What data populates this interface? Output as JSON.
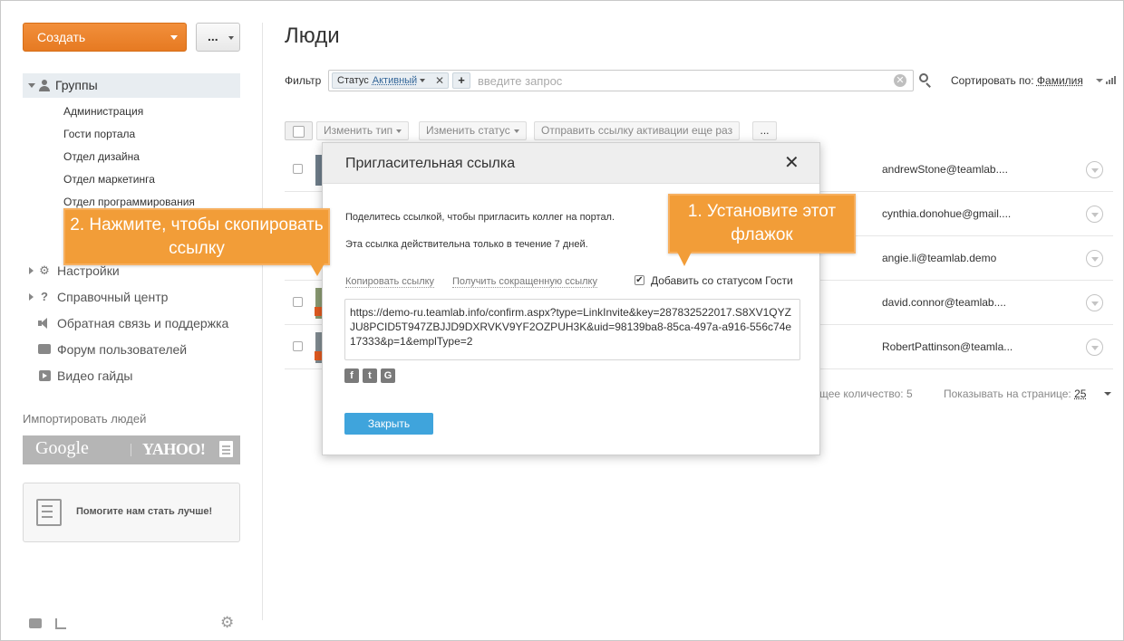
{
  "sidebar": {
    "create_label": "Создать",
    "more_label": "...",
    "groups_label": "Группы",
    "groups": [
      "Администрация",
      "Гости портала",
      "Отдел дизайна",
      "Отдел маркетинга",
      "Отдел программирования"
    ],
    "nav": {
      "settings": "Настройки",
      "help": "Справочный центр",
      "feedback": "Обратная связь и поддержка",
      "forum": "Форум пользователей",
      "videos": "Видео гайды"
    },
    "import_label": "Импортировать людей",
    "import_google": "Google",
    "import_yahoo": "YAHOO!",
    "help_us": "Помогите нам стать лучше!"
  },
  "main": {
    "title": "Люди",
    "filter_label": "Фильтр",
    "filter_chip_key": "Статус",
    "filter_chip_value": "Активный",
    "filter_add": "+",
    "filter_placeholder": "введите запрос",
    "sort_label": "Сортировать по:",
    "sort_value": "Фамилия",
    "toolbar": {
      "change_type": "Изменить тип",
      "change_status": "Изменить статус",
      "send_activation": "Отправить ссылку активации еще раз",
      "more": "..."
    },
    "rows": [
      {
        "email": "andrewStone@teamlab...."
      },
      {
        "email": "cynthia.donohue@gmail...."
      },
      {
        "email": "angie.li@teamlab.demo"
      },
      {
        "email": "david.connor@teamlab...."
      },
      {
        "email": "RobertPattinson@teamla..."
      }
    ],
    "pager_total_label": "щее количество:",
    "pager_total": "5",
    "pager_per_label": "Показывать на странице:",
    "pager_per": "25"
  },
  "modal": {
    "title": "Пригласительная ссылка",
    "close_symbol": "✕",
    "text1": "Поделитесь ссылкой, чтобы пригласить коллег на портал.",
    "text2": "Эта ссылка действительна только в течение 7 дней.",
    "copy_link": "Копировать ссылку",
    "short_link": "Получить сокращенную ссылку",
    "guest_label": "Добавить со статусом Гости",
    "guest_checked": true,
    "link": "https://demo-ru.teamlab.info/confirm.aspx?type=LinkInvite&key=287832522017.S8XV1QYZJU8PCID5T947ZBJJD9DXRVKV9YF2OZPUH3K&uid=98139ba8-85ca-497a-a916-556c74e17333&p=1&emplType=2",
    "social": [
      "f",
      "t",
      "G"
    ],
    "close_button": "Закрыть"
  },
  "callouts": {
    "copy": "2. Нажмите, чтобы скопировать ссылку",
    "check": "1. Установите этот флажок"
  },
  "colors": {
    "accent_orange": "#e67a22",
    "callout": "#f29d38",
    "primary_blue": "#3fa4dc"
  }
}
